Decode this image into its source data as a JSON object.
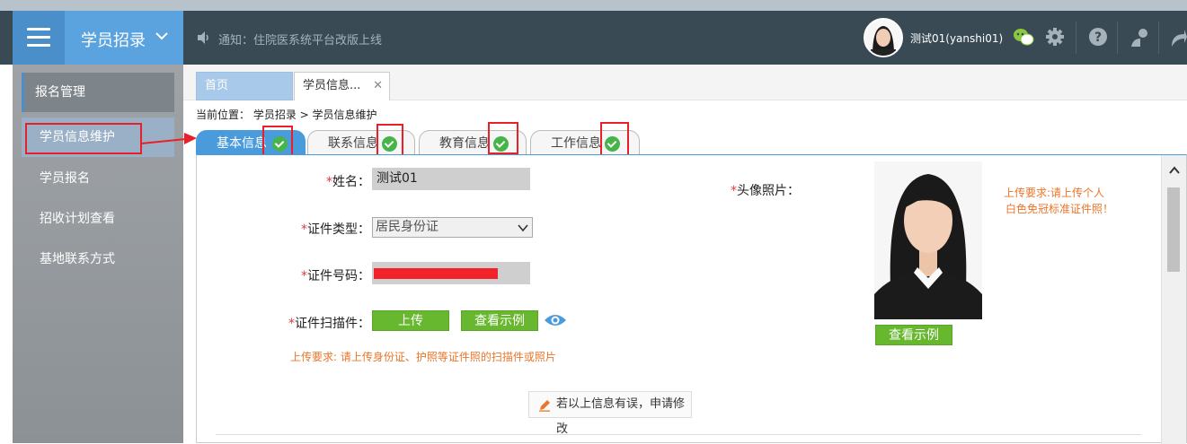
{
  "header": {
    "brand_title": "学员招录",
    "notice": "通知：住院医系统平台改版上线",
    "username": "测试01(yanshi01)"
  },
  "sidebar": {
    "items": [
      {
        "label": "报名管理"
      },
      {
        "label": "学员信息维护"
      },
      {
        "label": "学员报名"
      },
      {
        "label": "招收计划查看"
      },
      {
        "label": "基地联系方式"
      }
    ]
  },
  "page_tabs": [
    {
      "label": "首页"
    },
    {
      "label": "学员信息..."
    }
  ],
  "breadcrumb": "当前位置： 学员招录 > 学员信息维护",
  "info_tabs": [
    {
      "label": "基本信息"
    },
    {
      "label": "联系信息"
    },
    {
      "label": "教育信息"
    },
    {
      "label": "工作信息"
    }
  ],
  "form": {
    "name_label": "姓名：",
    "name_value": "测试01",
    "idtype_label": "证件类型：",
    "idtype_value": "居民身份证",
    "idnum_label": "证件号码：",
    "scan_label": "证件扫描件：",
    "upload_btn": "上传",
    "view_example_btn": "查看示例",
    "scan_hint": "上传要求: 请上传身份证、护照等证件照的扫描件或照片",
    "photo_label": "头像照片：",
    "photo_hint_1": "上传要求:请上传个人",
    "photo_hint_2": "白色免冠标准证件照！",
    "photo_view_btn": "查看示例",
    "edit_btn": "若以上信息有误，申请修改",
    "required_mark": "*"
  },
  "colors": {
    "topbar": "#394a55",
    "brand": "#5aa3df",
    "accent_blue": "#4a9bdc",
    "check_green": "#45b549",
    "button_green": "#67b72f",
    "highlight_red": "#e8202a",
    "hint_orange": "#e8762c"
  }
}
